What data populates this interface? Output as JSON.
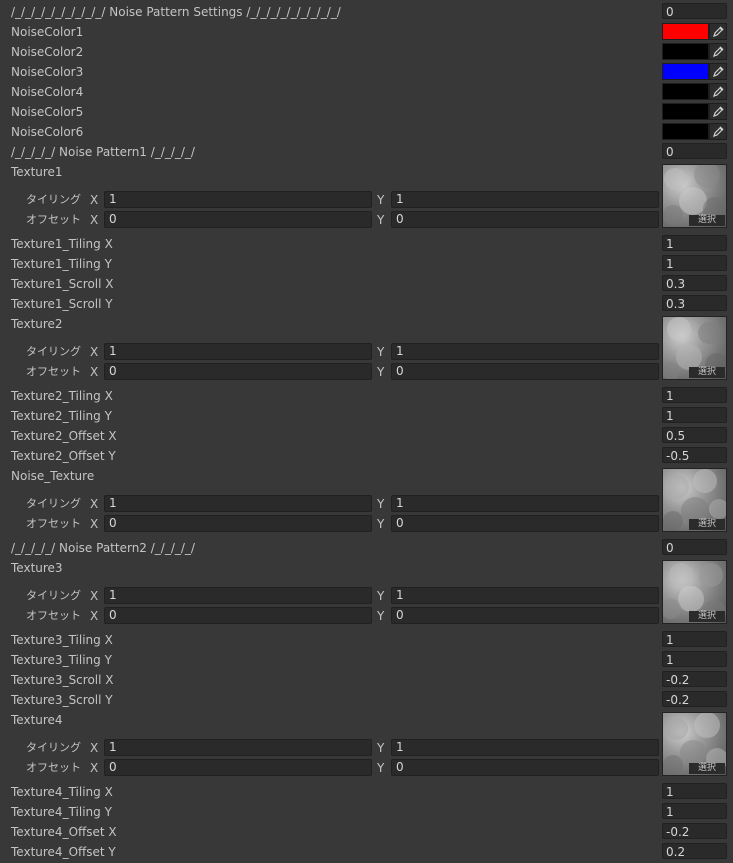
{
  "header": {
    "title": "/_/_/_/_/_/_/_/_/_/  Noise Pattern Settings /_/_/_/_/_/_/_/_/_/",
    "value": "0"
  },
  "colors": [
    {
      "label": "NoiseColor1",
      "hex": "#ff0000"
    },
    {
      "label": "NoiseColor2",
      "hex": "#000000"
    },
    {
      "label": "NoiseColor3",
      "hex": "#0000ff"
    },
    {
      "label": "NoiseColor4",
      "hex": "#000000"
    },
    {
      "label": "NoiseColor5",
      "hex": "#000000"
    },
    {
      "label": "NoiseColor6",
      "hex": "#000000"
    }
  ],
  "pattern1": {
    "title": "/_/_/_/_/ Noise Pattern1 /_/_/_/_/",
    "value": "0"
  },
  "pattern2": {
    "title": "/_/_/_/_/ Noise Pattern2 /_/_/_/_/",
    "value": "0"
  },
  "common": {
    "tiling": "タイリング",
    "offset": "オフセット",
    "x": "X",
    "y": "Y",
    "select": "選択"
  },
  "textures": [
    {
      "name": "Texture1",
      "tiling_x": "1",
      "tiling_y": "1",
      "offset_x": "0",
      "offset_y": "0"
    },
    {
      "name": "Texture2",
      "tiling_x": "1",
      "tiling_y": "1",
      "offset_x": "0",
      "offset_y": "0"
    },
    {
      "name": "Noise_Texture",
      "tiling_x": "1",
      "tiling_y": "1",
      "offset_x": "0",
      "offset_y": "0"
    },
    {
      "name": "Texture3",
      "tiling_x": "1",
      "tiling_y": "1",
      "offset_x": "0",
      "offset_y": "0"
    },
    {
      "name": "Texture4",
      "tiling_x": "1",
      "tiling_y": "1",
      "offset_x": "0",
      "offset_y": "0"
    }
  ],
  "props": {
    "t1": [
      {
        "label": "Texture1_Tiling X",
        "value": "1"
      },
      {
        "label": "Texture1_Tiling Y",
        "value": "1"
      },
      {
        "label": "Texture1_Scroll X",
        "value": "0.3"
      },
      {
        "label": "Texture1_Scroll Y",
        "value": "0.3"
      }
    ],
    "t2": [
      {
        "label": "Texture2_Tiling X",
        "value": "1"
      },
      {
        "label": "Texture2_Tiling Y",
        "value": "1"
      },
      {
        "label": "Texture2_Offset X",
        "value": "0.5"
      },
      {
        "label": "Texture2_Offset Y",
        "value": "-0.5"
      }
    ],
    "t3": [
      {
        "label": "Texture3_Tiling X",
        "value": "1"
      },
      {
        "label": "Texture3_Tiling Y",
        "value": "1"
      },
      {
        "label": "Texture3_Scroll X",
        "value": "-0.2"
      },
      {
        "label": "Texture3_Scroll Y",
        "value": "-0.2"
      }
    ],
    "t4": [
      {
        "label": "Texture4_Tiling X",
        "value": "1"
      },
      {
        "label": "Texture4_Tiling Y",
        "value": "1"
      },
      {
        "label": "Texture4_Offset X",
        "value": "-0.2"
      },
      {
        "label": "Texture4_Offset Y",
        "value": "0.2"
      }
    ]
  }
}
